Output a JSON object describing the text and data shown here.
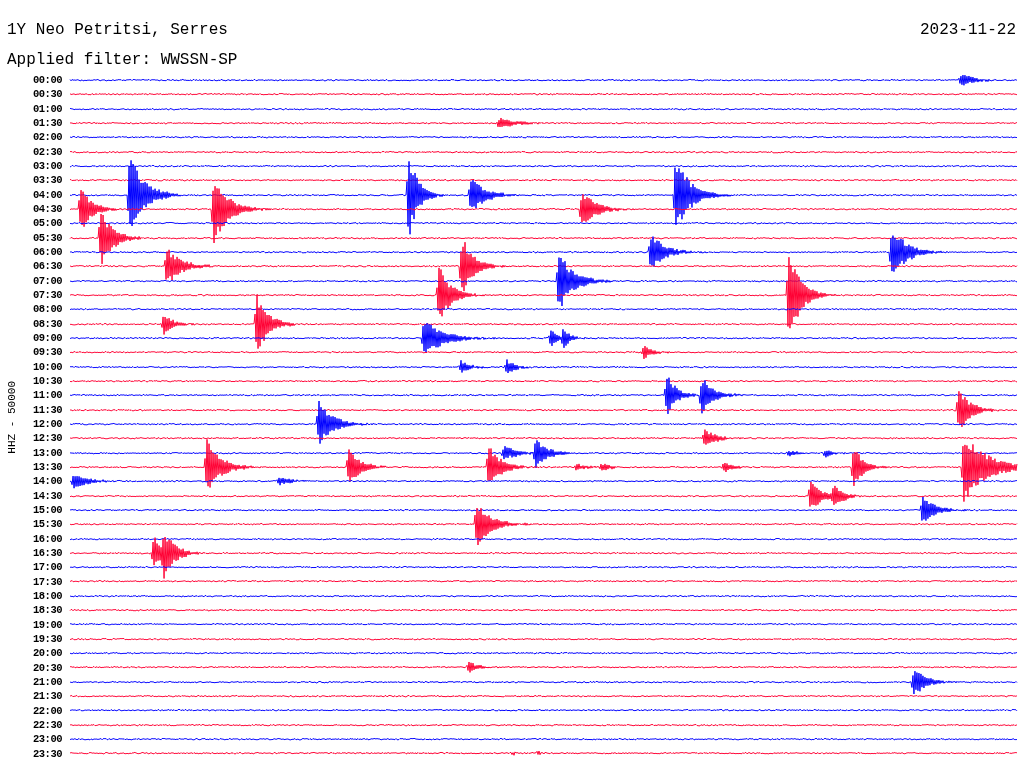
{
  "header": {
    "station": "1Y Neo Petritsi, Serres",
    "date": "2023-11-22",
    "filter": "Applied filter: WWSSN-SP"
  },
  "plot": {
    "axis_label": "HHZ - 50000",
    "rows": [
      {
        "time": "00:00",
        "color": "#0000ff"
      },
      {
        "time": "00:30",
        "color": "#ff0033"
      },
      {
        "time": "01:00",
        "color": "#0000ff"
      },
      {
        "time": "01:30",
        "color": "#ff0033"
      },
      {
        "time": "02:00",
        "color": "#0000ff"
      },
      {
        "time": "02:30",
        "color": "#ff0033"
      },
      {
        "time": "03:00",
        "color": "#0000ff"
      },
      {
        "time": "03:30",
        "color": "#ff0033"
      },
      {
        "time": "04:00",
        "color": "#0000ff"
      },
      {
        "time": "04:30",
        "color": "#ff0033"
      },
      {
        "time": "05:00",
        "color": "#0000ff"
      },
      {
        "time": "05:30",
        "color": "#ff0033"
      },
      {
        "time": "06:00",
        "color": "#0000ff"
      },
      {
        "time": "06:30",
        "color": "#ff0033"
      },
      {
        "time": "07:00",
        "color": "#0000ff"
      },
      {
        "time": "07:30",
        "color": "#ff0033"
      },
      {
        "time": "08:00",
        "color": "#0000ff"
      },
      {
        "time": "08:30",
        "color": "#ff0033"
      },
      {
        "time": "09:00",
        "color": "#0000ff"
      },
      {
        "time": "09:30",
        "color": "#ff0033"
      },
      {
        "time": "10:00",
        "color": "#0000ff"
      },
      {
        "time": "10:30",
        "color": "#ff0033"
      },
      {
        "time": "11:00",
        "color": "#0000ff"
      },
      {
        "time": "11:30",
        "color": "#ff0033"
      },
      {
        "time": "12:00",
        "color": "#0000ff"
      },
      {
        "time": "12:30",
        "color": "#ff0033"
      },
      {
        "time": "13:00",
        "color": "#0000ff"
      },
      {
        "time": "13:30",
        "color": "#ff0033"
      },
      {
        "time": "14:00",
        "color": "#0000ff"
      },
      {
        "time": "14:30",
        "color": "#ff0033"
      },
      {
        "time": "15:00",
        "color": "#0000ff"
      },
      {
        "time": "15:30",
        "color": "#ff0033"
      },
      {
        "time": "16:00",
        "color": "#0000ff"
      },
      {
        "time": "16:30",
        "color": "#ff0033"
      },
      {
        "time": "17:00",
        "color": "#0000ff"
      },
      {
        "time": "17:30",
        "color": "#ff0033"
      },
      {
        "time": "18:00",
        "color": "#0000ff"
      },
      {
        "time": "18:30",
        "color": "#ff0033"
      },
      {
        "time": "19:00",
        "color": "#0000ff"
      },
      {
        "time": "19:30",
        "color": "#ff0033"
      },
      {
        "time": "20:00",
        "color": "#0000ff"
      },
      {
        "time": "20:30",
        "color": "#ff0033"
      },
      {
        "time": "21:00",
        "color": "#0000ff"
      },
      {
        "time": "21:30",
        "color": "#ff0033"
      },
      {
        "time": "22:00",
        "color": "#0000ff"
      },
      {
        "time": "22:30",
        "color": "#ff0033"
      },
      {
        "time": "23:00",
        "color": "#0000ff"
      },
      {
        "time": "23:30",
        "color": "#ff0033"
      }
    ]
  }
}
